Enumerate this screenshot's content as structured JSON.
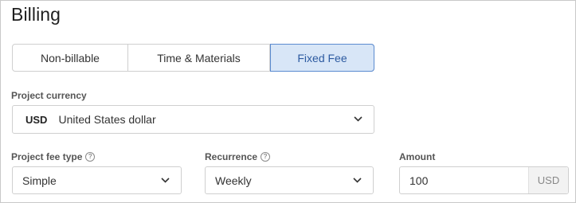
{
  "section": {
    "title": "Billing"
  },
  "billing_type": {
    "options": [
      "Non-billable",
      "Time & Materials",
      "Fixed Fee"
    ],
    "selected": "Fixed Fee"
  },
  "currency": {
    "label": "Project currency",
    "code": "USD",
    "name": "United States dollar"
  },
  "fee_type": {
    "label": "Project fee type",
    "value": "Simple",
    "help_icon": "help-icon"
  },
  "recurrence": {
    "label": "Recurrence",
    "value": "Weekly",
    "help_icon": "help-icon"
  },
  "amount": {
    "label": "Amount",
    "value": "100",
    "suffix": "USD"
  },
  "colors": {
    "selected_bg": "#d8e6f7",
    "selected_border": "#5b8bd0",
    "selected_text": "#2c5aa0"
  }
}
